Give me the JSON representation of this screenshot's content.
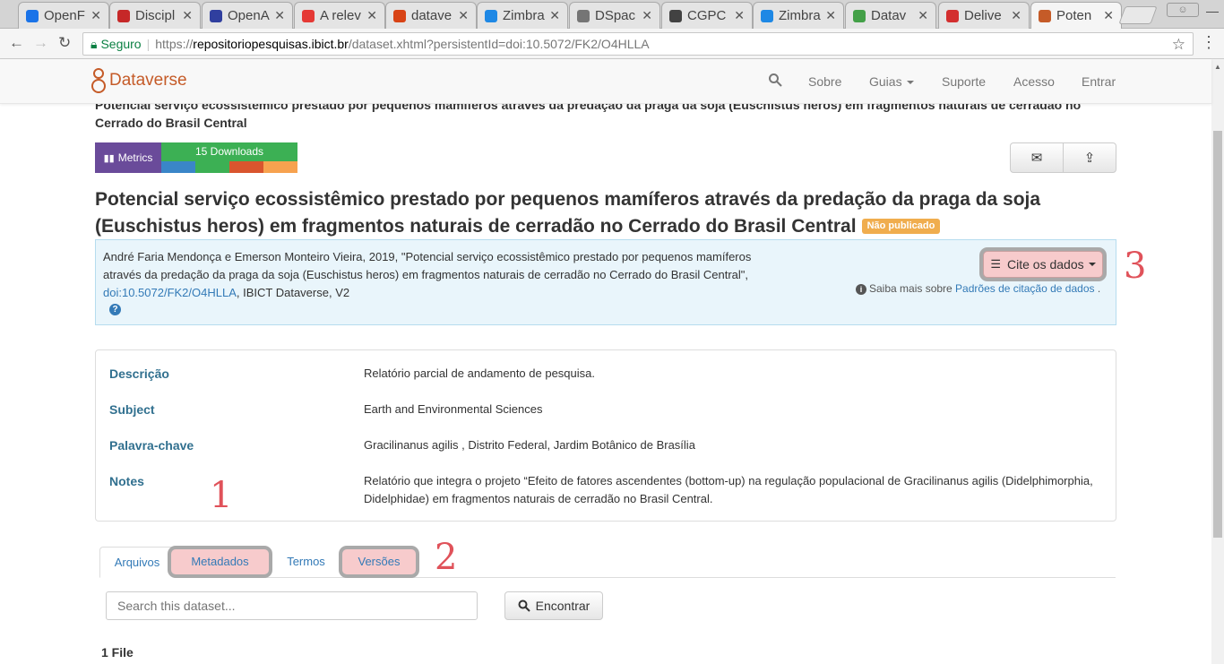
{
  "browser": {
    "tabs": [
      {
        "label": "OpenF",
        "color": "#1a73e8",
        "icon": "link-icon"
      },
      {
        "label": "Discipl",
        "color": "#c62828",
        "icon": "image-icon"
      },
      {
        "label": "OpenA",
        "color": "#303f9f",
        "icon": "circle-icon"
      },
      {
        "label": "A relev",
        "color": "#e53935",
        "icon": "gear-icon"
      },
      {
        "label": "datave",
        "color": "#d84315",
        "icon": "doc-icon"
      },
      {
        "label": "Zimbra",
        "color": "#1e88e5",
        "icon": "zimbra-icon"
      },
      {
        "label": "DSpac",
        "color": "#757575",
        "icon": "page-icon"
      },
      {
        "label": "CGPC",
        "color": "#424242",
        "icon": "doc-icon"
      },
      {
        "label": "Zimbra",
        "color": "#1e88e5",
        "icon": "zimbra-icon"
      },
      {
        "label": "Datav",
        "color": "#43a047",
        "icon": "leaf-icon"
      },
      {
        "label": "Delive",
        "color": "#d32f2f",
        "icon": "gmail-icon"
      },
      {
        "label": "Poten",
        "color": "#c55b28",
        "icon": "dataverse-icon"
      }
    ],
    "secure_label": "Seguro",
    "url_scheme": "https://",
    "url_host": "repositoriopesquisas.ibict.br",
    "url_path": "/dataset.xhtml?persistentId=doi:10.5072/FK2/O4HLLA"
  },
  "navbar": {
    "brand": "Dataverse",
    "items": [
      "Sobre",
      "Guias",
      "Suporte",
      "Acesso",
      "Entrar"
    ]
  },
  "dataset": {
    "top_title": "Potencial serviço ecossistêmico prestado por pequenos mamíferos através da predação da praga da soja (Euschistus heros) em fragmentos naturais de cerradão no Cerrado do Brasil Central",
    "metrics_label": "Metrics",
    "downloads_label": "15 Downloads",
    "title": "Potencial serviço ecossistêmico prestado por pequenos mamíferos através da predação da praga da soja (Euschistus heros) em fragmentos naturais de cerradão no Cerrado do Brasil Central",
    "status_badge": "Não publicado",
    "citation_text": "André Faria Mendonça e Emerson Monteiro Vieira, 2019, \"Potencial serviço ecossistêmico prestado por pequenos mamíferos através da predação da praga da soja (Euschistus heros) em fragmentos naturais de cerradão no Cerrado do Brasil Central\", ",
    "citation_doi": "doi:10.5072/FK2/O4HLLA",
    "citation_tail": ", IBICT Dataverse, V2",
    "cite_button": "Cite os dados",
    "learn_prefix": "Saiba mais sobre ",
    "learn_link": "Padrões de citação de dados",
    "learn_suffix": " ."
  },
  "metadata": [
    {
      "label": "Descrição",
      "value": "Relatório parcial de andamento de pesquisa."
    },
    {
      "label": "Subject",
      "value": "Earth and Environmental Sciences"
    },
    {
      "label": "Palavra-chave",
      "value": "Gracilinanus agilis , Distrito Federal, Jardim Botânico de Brasília"
    },
    {
      "label": "Notes",
      "value": "Relatório que integra o projeto “Efeito de fatores ascendentes (bottom-up) na regulação populacional de Gracilinanus agilis (Didelphimorphia, Didelphidae) em fragmentos naturais de cerradão no Brasil Central."
    }
  ],
  "tabs": [
    "Arquivos",
    "Metadados",
    "Termos",
    "Versões"
  ],
  "annotations": [
    "1",
    "2",
    "3"
  ],
  "search": {
    "placeholder": "Search this dataset...",
    "button": "Encontrar"
  },
  "file_count": "1 File",
  "colors": {
    "brand": "#c55b28",
    "metrics": "#6a4b9a",
    "downloads": "#3cb054",
    "highlight": "#f7cbcc",
    "annotation": "#e0525a",
    "link": "#337ab7",
    "badge": "#f0ad4e"
  }
}
